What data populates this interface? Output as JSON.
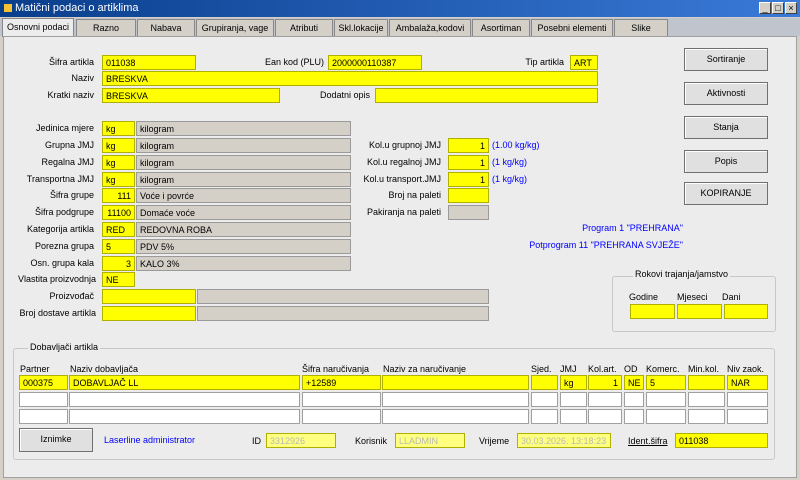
{
  "window": {
    "title": "Matični podaci o artiklima"
  },
  "tabs": [
    "Osnovni podaci",
    "Razno",
    "Nabava",
    "Grupiranja, vage",
    "Atributi",
    "Skl.lokacije",
    "Ambalaža,kodovi",
    "Asortiman",
    "Posebni elementi",
    "Slike"
  ],
  "labels": {
    "sifra_artikla": "Šifra artikla",
    "naziv": "Naziv",
    "kratki_naziv": "Kratki naziv",
    "ean": "Ean kod (PLU)",
    "tip_artikla": "Tip artikla",
    "dodatni_opis": "Dodatni opis",
    "jedinica_mjere": "Jedinica mjere",
    "grupna_jmj": "Grupna JMJ",
    "regalna_jmj": "Regalna JMJ",
    "transportna_jmj": "Transportna JMJ",
    "sifra_grupe": "Šifra grupe",
    "sifra_podgrupe": "Šifra podgrupe",
    "kategorija": "Kategorija artikla",
    "porezna": "Porezna grupa",
    "osn_grupa_kala": "Osn. grupa kala",
    "vlastita": "Vlastita proizvodnja",
    "proizvodac": "Proizvođač",
    "broj_dostave": "Broj dostave artikla",
    "kol_grupnoj": "Kol.u grupnoj JMJ",
    "kol_regalnoj": "Kol.u regalnoj JMJ",
    "kol_transport": "Kol.u transport.JMJ",
    "broj_na_paleti": "Broj na paleti",
    "pakiranja": "Pakiranja na paleti",
    "rokovi": "Rokovi trajanja/jamstvo",
    "godine": "Godine",
    "mjeseci": "Mjeseci",
    "dani": "Dani",
    "dobavljaci": "Dobavljači artikla",
    "id": "ID",
    "korisnik": "Korisnik",
    "vrijeme": "Vrijeme",
    "ident_sifra": "Ident.šifra"
  },
  "fields": {
    "sifra_artikla": "011038",
    "naziv": "BRESKVA",
    "kratki_naziv": "BRESKVA",
    "ean": "2000000110387",
    "tip_artikla": "ART",
    "dodatni_opis": "",
    "jm_code": "kg",
    "jm_name": "kilogram",
    "grupna_code": "kg",
    "grupna_name": "kilogram",
    "regalna_code": "kg",
    "regalna_name": "kilogram",
    "transportna_code": "kg",
    "transportna_name": "kilogram",
    "grupa_code": "111",
    "grupa_name": "Voće i povrće",
    "podgrupa_code": "11100",
    "podgrupa_name": "Domaće voće",
    "kategorija_code": "RED",
    "kategorija_name": "REDOVNA ROBA",
    "porezna_code": "5",
    "porezna_name": "PDV 5%",
    "kala_code": "3",
    "kala_name": "KALO 3%",
    "vlastita": "NE",
    "kol_grupnoj": "1",
    "kol_grupnoj_note": "(1.00 kg/kg)",
    "kol_regalnoj": "1",
    "kol_regalnoj_note": "(1 kg/kg)",
    "kol_transport": "1",
    "kol_transport_note": "(1 kg/kg)",
    "program": "Program 1 \"PREHRANA\"",
    "potprogram": "Potprogram 11 \"PREHRANA SVJEŽE\"",
    "id": "3312926",
    "korisnik": "LLADMIN",
    "vrijeme": "30.03.2026. 13:18:23",
    "ident_sifra": "011038",
    "laserline": "Laserline administrator"
  },
  "buttons": {
    "sortiranje": "Sortiranje",
    "aktivnosti": "Aktivnosti",
    "stanja": "Stanja",
    "popis": "Popis",
    "kopiranje": "KOPIRANJE",
    "iznimke": "Iznimke"
  },
  "suppliers": {
    "columns": [
      "Partner",
      "Naziv dobavljača",
      "Šifra naručivanja",
      "Naziv za naručivanje",
      "Sjed.",
      "JMJ",
      "Kol.art.",
      "OD",
      "Komerc.",
      "Min.kol.",
      "Niv zaok."
    ],
    "rows": [
      {
        "partner": "000375",
        "naziv": "DOBAVLJAČ LL",
        "sifra": "+12589",
        "naziv_nar": "",
        "sjed": "",
        "jmj": "kg",
        "kol": "1",
        "od": "NE",
        "komerc": "5",
        "min": "",
        "niv": "NAR"
      }
    ]
  }
}
